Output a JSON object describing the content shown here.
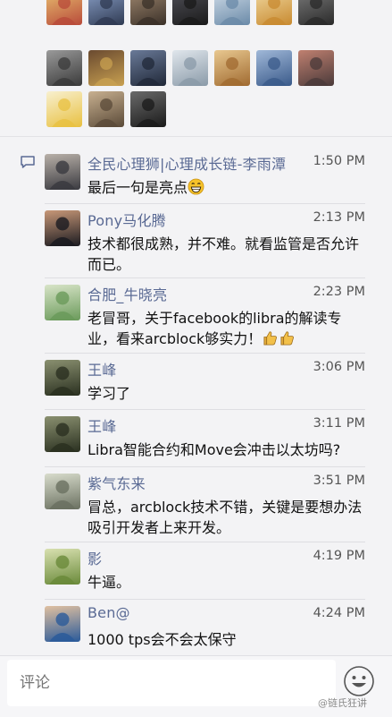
{
  "likes": {
    "avatars": [
      {
        "name": "liker-avatar-1",
        "c1": "#b84a3a",
        "c2": "#e8c070"
      },
      {
        "name": "liker-avatar-2",
        "c1": "#2f3a52",
        "c2": "#8aa0c8"
      },
      {
        "name": "liker-avatar-3",
        "c1": "#3a3028",
        "c2": "#a08870"
      },
      {
        "name": "liker-avatar-4",
        "c1": "#1a1a1a",
        "c2": "#505058"
      },
      {
        "name": "liker-avatar-5",
        "c1": "#6a8aa8",
        "c2": "#d0dce8"
      },
      {
        "name": "liker-avatar-6",
        "c1": "#c88a30",
        "c2": "#f0d8a0"
      },
      {
        "name": "liker-avatar-7",
        "c1": "#2a2a2a",
        "c2": "#7a7a7a"
      },
      {
        "name": "liker-avatar-8",
        "c1": "#3a3a3a",
        "c2": "#9a9a9a"
      },
      {
        "name": "liker-avatar-9",
        "c1": "#c8a050",
        "c2": "#6a4a30"
      },
      {
        "name": "liker-avatar-10",
        "c1": "#202838",
        "c2": "#6a7a98"
      },
      {
        "name": "liker-avatar-11",
        "c1": "#8a9aa8",
        "c2": "#e0e6ec"
      },
      {
        "name": "liker-avatar-12",
        "c1": "#a06a30",
        "c2": "#e8c890"
      },
      {
        "name": "liker-avatar-13",
        "c1": "#3a5a8a",
        "c2": "#a0b8d8"
      },
      {
        "name": "liker-avatar-14",
        "c1": "#4a3a3a",
        "c2": "#c08070"
      },
      {
        "name": "liker-avatar-15",
        "c1": "#e8c040",
        "c2": "#f8f0d0"
      },
      {
        "name": "liker-avatar-16",
        "c1": "#5a4a38",
        "c2": "#c8b090"
      },
      {
        "name": "liker-avatar-17",
        "c1": "#1a1a1a",
        "c2": "#6a6a6a"
      }
    ]
  },
  "comments": [
    {
      "name": "全民心理狮|心理成长链-李雨潭",
      "time": "1:50 PM",
      "text": "最后一句是亮点",
      "emoji": "grin",
      "avatar": {
        "c1": "#3a3a40",
        "c2": "#b8b0a8"
      }
    },
    {
      "name": "Pony马化腾",
      "time": "2:13 PM",
      "text": "技术都很成熟，并不难。就看监管是否允许而已。",
      "emoji": "",
      "avatar": {
        "c1": "#1a1a20",
        "c2": "#c89878"
      }
    },
    {
      "name": "合肥_牛晓亮",
      "time": "2:23 PM",
      "text": "老冒哥，关于facebook的libra的解读专业，看来arcblock够实力！",
      "emoji": "thumbs",
      "avatar": {
        "c1": "#6a9a5a",
        "c2": "#d8e4c8"
      }
    },
    {
      "name": "王峰",
      "time": "3:06 PM",
      "text": "学习了",
      "emoji": "",
      "avatar": {
        "c1": "#2a3020",
        "c2": "#8a9070"
      }
    },
    {
      "name": "王峰",
      "time": "3:11 PM",
      "text": "Libra智能合约和Move会冲击以太坊吗?",
      "emoji": "",
      "avatar": {
        "c1": "#2a3020",
        "c2": "#8a9070"
      }
    },
    {
      "name": "紫气东来",
      "time": "3:51 PM",
      "text": "冒总，arcblock技术不错，关键是要想办法吸引开发者上来开发。",
      "emoji": "",
      "avatar": {
        "c1": "#6a7060",
        "c2": "#d8dccc"
      }
    },
    {
      "name": "影",
      "time": "4:19 PM",
      "text": "牛逼。",
      "emoji": "",
      "avatar": {
        "c1": "#6a8a3a",
        "c2": "#d8e0b0"
      }
    },
    {
      "name": "Ben@",
      "time": "4:24 PM",
      "text": "1000 tps会不会太保守",
      "emoji": "",
      "avatar": {
        "c1": "#2a5a9a",
        "c2": "#e0c0a0"
      }
    }
  ],
  "input": {
    "placeholder": "评论"
  },
  "watermark": "@链氏狂讲",
  "colors": {
    "name": "#5a6a94",
    "panel": "#f3f3f5",
    "text": "#111111"
  },
  "icons": {
    "comment": "comment-bubble-icon",
    "emoji": "smiley-face-icon"
  }
}
